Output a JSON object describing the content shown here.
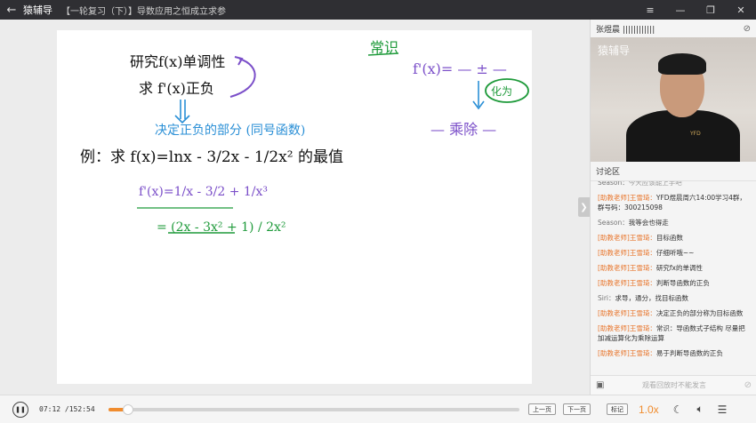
{
  "titlebar": {
    "back_icon": "arrow-left-icon",
    "app_name": "猿辅导",
    "lesson_title": "【一轮复习（下）】导数应用之恒成立求参",
    "controls": [
      "≡",
      "—",
      "❐",
      "✕"
    ]
  },
  "board": {
    "lines": {
      "l1": "研究f(x)单调性",
      "l2": "求 f'(x)正负",
      "l3": "决定正负的部分 (同号函数)",
      "l4": "例：求 f(x)=lnx - 3/2x - 1/2x² 的最值",
      "l5": "f'(x)=1/x - 3/2 + 1/x³",
      "l6": "= (2x - 3x² + 1) / 2x²",
      "r1": "常识",
      "r2": "f'(x)= — ± —",
      "r3": "↓",
      "r4": "化为",
      "r5": "— 乘除 —"
    },
    "colors": {
      "ink": "#111111",
      "purple": "#7b4fc9",
      "blue": "#2a8fd6",
      "green": "#1e9a3a"
    }
  },
  "side": {
    "teacher_name": "张煜晨 ||||||||||||",
    "cam_icon": "camera-off-icon",
    "video_logo": "猿辅导",
    "video_shirt_text": "YFD",
    "chat_title": "讨论区",
    "messages": [
      {
        "who": "Season：",
        "text": "今天应该能上手吧",
        "teacher": false
      },
      {
        "who": "[助教老师]王雪琦：",
        "text": "YFD煜晨周六14:00学习4群，群号码：300215098",
        "teacher": true
      },
      {
        "who": "Season：",
        "text": "我等会也得走",
        "teacher": false
      },
      {
        "who": "[助教老师]王雪琦：",
        "text": "目标函数",
        "teacher": true
      },
      {
        "who": "[助教老师]王雪琦：",
        "text": "仔细听哦~~",
        "teacher": true
      },
      {
        "who": "[助教老师]王雪琦：",
        "text": "研究fx的单调性",
        "teacher": true
      },
      {
        "who": "[助教老师]王雪琦：",
        "text": "判断导函数的正负",
        "teacher": true
      },
      {
        "who": "Siri：",
        "text": "求导，通分，找目标函数",
        "teacher": false
      },
      {
        "who": "[助教老师]王雪琦：",
        "text": "决定正负的部分称为目标函数",
        "teacher": true
      },
      {
        "who": "[助教老师]王雪琦：",
        "text": "常识：导函数式子结构 尽量把加减运算化为乘除运算",
        "teacher": true
      },
      {
        "who": "[助教老师]王雪琦：",
        "text": "易于判断导函数的正负",
        "teacher": true
      }
    ],
    "input_placeholder": "观看回放时不能发言",
    "collapse_icon": "chevron-right-icon"
  },
  "player": {
    "current_time": "07:12",
    "total_time": "/152:54",
    "progress": 0.047,
    "prev_label": "上一页",
    "next_label": "下一页",
    "mark_label": "标记",
    "speed": "1.0x"
  }
}
